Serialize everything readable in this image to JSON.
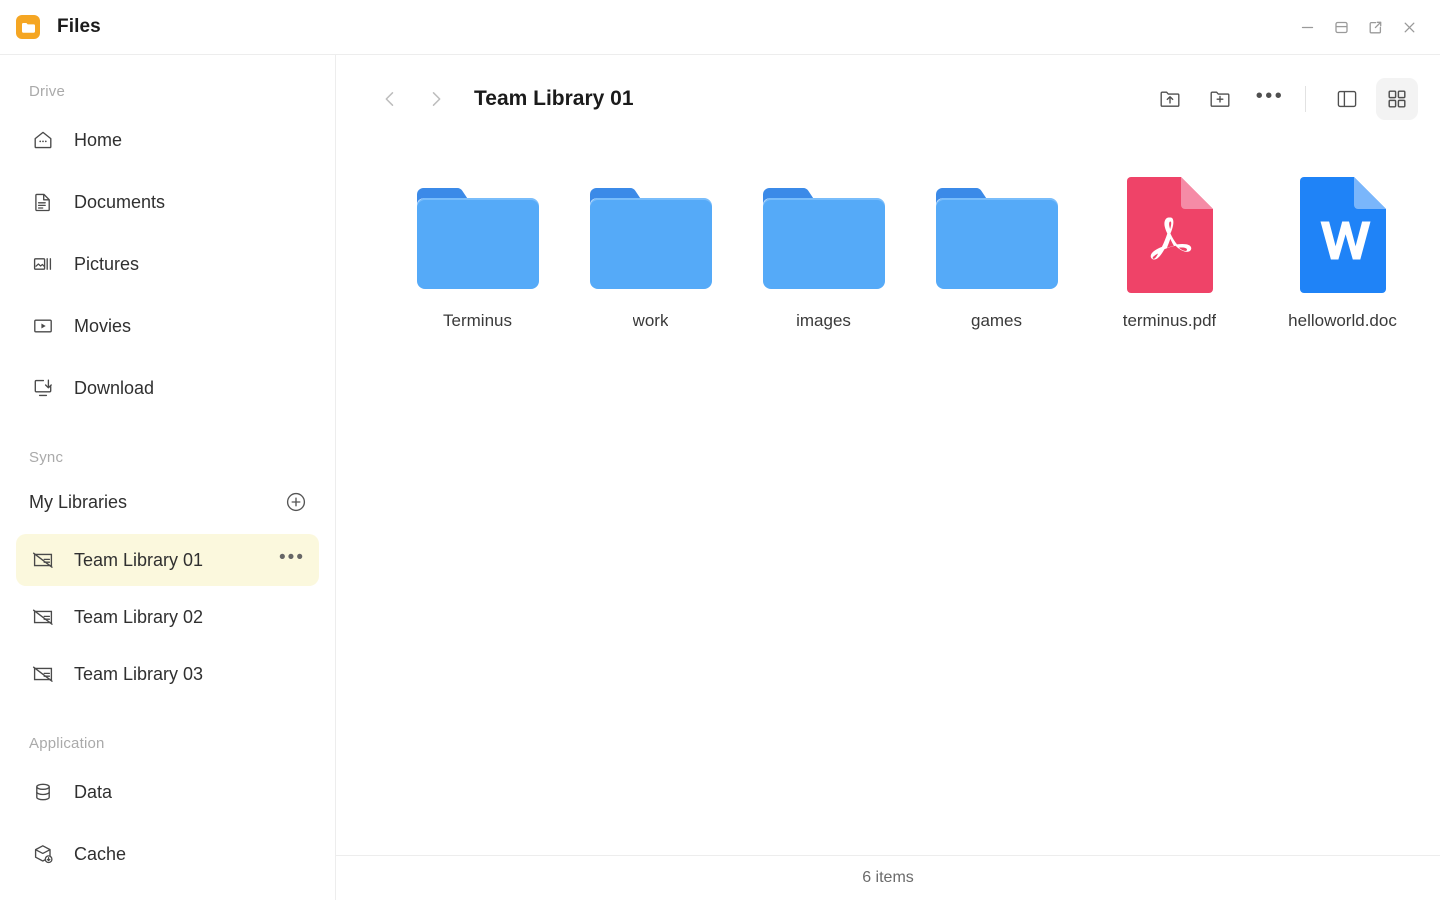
{
  "window": {
    "app_icon": "folder-app-icon",
    "title": "Files",
    "controls": [
      {
        "name": "minimize-button",
        "icon": "minimize-icon"
      },
      {
        "name": "restore-button",
        "icon": "restore-window-icon"
      },
      {
        "name": "popout-button",
        "icon": "external-link-icon"
      },
      {
        "name": "close-button",
        "icon": "close-icon"
      }
    ]
  },
  "sidebar": {
    "drive_label": "Drive",
    "drive_items": [
      {
        "label": "Home",
        "icon": "home-icon"
      },
      {
        "label": "Documents",
        "icon": "document-icon"
      },
      {
        "label": "Pictures",
        "icon": "pictures-icon"
      },
      {
        "label": "Movies",
        "icon": "movies-icon"
      },
      {
        "label": "Download",
        "icon": "download-icon"
      }
    ],
    "sync_label": "Sync",
    "my_libraries_label": "My Libraries",
    "add_library_icon": "plus-circle-icon",
    "libraries": [
      {
        "label": "Team Library 01",
        "icon": "library-icon",
        "active": true,
        "menu": "•••"
      },
      {
        "label": "Team Library 02",
        "icon": "library-icon",
        "active": false
      },
      {
        "label": "Team Library 03",
        "icon": "library-icon",
        "active": false
      }
    ],
    "application_label": "Application",
    "application_items": [
      {
        "label": "Data",
        "icon": "database-icon"
      },
      {
        "label": "Cache",
        "icon": "cache-box-icon"
      }
    ],
    "active_highlight_color": "#fbf8dd"
  },
  "toolbar": {
    "back_icon": "chevron-left-icon",
    "forward_icon": "chevron-right-icon",
    "breadcrumb": "Team Library 01",
    "actions": [
      {
        "name": "upload-folder-button",
        "icon": "folder-upload-icon"
      },
      {
        "name": "new-folder-button",
        "icon": "folder-plus-icon"
      },
      {
        "name": "more-options-button",
        "icon": "more-horizontal-icon",
        "label": "•••"
      }
    ],
    "view_toggles": [
      {
        "name": "list-view-button",
        "icon": "panel-view-icon",
        "active": false
      },
      {
        "name": "grid-view-button",
        "icon": "grid-view-icon",
        "active": true
      }
    ]
  },
  "files": [
    {
      "name": "Terminus",
      "type": "folder"
    },
    {
      "name": "work",
      "type": "folder"
    },
    {
      "name": "images",
      "type": "folder"
    },
    {
      "name": "games",
      "type": "folder"
    },
    {
      "name": "terminus.pdf",
      "type": "pdf"
    },
    {
      "name": "helloworld.doc",
      "type": "doc"
    }
  ],
  "statusbar": {
    "item_count_text": "6 items"
  },
  "colors": {
    "folder_body": "#55aaf8",
    "folder_tab": "#3b8ae8",
    "pdf": "#ef4368",
    "doc": "#1f83f7",
    "app_icon": "#f5a623",
    "highlight": "#fbf8dd"
  }
}
